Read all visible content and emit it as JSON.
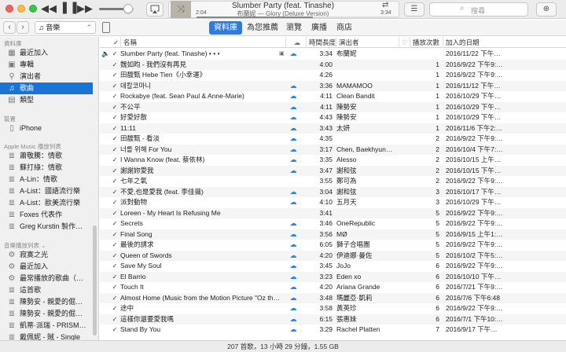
{
  "player": {
    "track_title": "Slumber Party (feat. Tinashe)",
    "track_sub": "布蘭妮 — Glory (Deluxe Version)",
    "elapsed": "2:04",
    "remaining": "3:34",
    "volume": 0.85
  },
  "search": {
    "placeholder": "搜尋"
  },
  "source_select": {
    "label": "音樂"
  },
  "tabs": [
    {
      "label": "資料庫",
      "active": true
    },
    {
      "label": "為您推薦"
    },
    {
      "label": "瀏覽"
    },
    {
      "label": "廣播"
    },
    {
      "label": "商店"
    }
  ],
  "sidebar": {
    "library_heading": "資料庫",
    "library": [
      {
        "label": "最近加入",
        "icon": "clock-icon"
      },
      {
        "label": "專輯",
        "icon": "album-icon"
      },
      {
        "label": "演出者",
        "icon": "microphone-icon"
      },
      {
        "label": "歌曲",
        "icon": "note-icon",
        "active": true
      },
      {
        "label": "類型",
        "icon": "genre-icon"
      }
    ],
    "devices_heading": "裝置",
    "devices": [
      {
        "label": "iPhone",
        "icon": "iphone-icon"
      }
    ],
    "applemusic_heading": "Apple Music 播放列表",
    "applemusic": [
      {
        "label": "蕭敬騰：情歌"
      },
      {
        "label": "蘇打綠：情歌"
      },
      {
        "label": "A-Lin：情歌"
      },
      {
        "label": "A-List：國語流行樂"
      },
      {
        "label": "A-List：歐美流行樂"
      },
      {
        "label": "Foxes 代表作"
      },
      {
        "label": "Greg Kurstin 製作…"
      }
    ],
    "music_playlists_heading": "音樂播放列表 ⌄",
    "music_playlists": [
      {
        "label": "寂寞之光",
        "icon": "gear-icon"
      },
      {
        "label": "最近加入",
        "icon": "gear-icon"
      },
      {
        "label": "最常播放的歌曲（…",
        "icon": "gear-icon"
      },
      {
        "label": "這首歌",
        "icon": "playlist-icon"
      },
      {
        "label": "陳勢安 - 親愛的倔…",
        "icon": "playlist-icon"
      },
      {
        "label": "陳勢安 - 親愛的倔…",
        "icon": "playlist-icon"
      },
      {
        "label": "凱蒂·派瑞 - PRISM…",
        "icon": "playlist-icon"
      },
      {
        "label": "戴佩妮 - 賊 - Single",
        "icon": "playlist-icon"
      }
    ]
  },
  "columns": {
    "name": "名稱",
    "time": "時間長度",
    "artist": "演出者",
    "plays": "播放次數",
    "date": "加入的日期"
  },
  "songs": [
    {
      "name": "Slumber Party (feat. Tinashe) • • •",
      "cloud": true,
      "time": "3:34",
      "artist": "布蘭妮",
      "plays": "",
      "date": "2016/11/22 下午…",
      "playing": true
    },
    {
      "name": "魏如昀 - 我們沒有再見",
      "cloud": false,
      "time": "4:00",
      "artist": "",
      "plays": "1",
      "date": "2016/9/22 下午9:…"
    },
    {
      "name": "田馥甄  Hebe Tien《小幸運》",
      "cloud": false,
      "time": "4:26",
      "artist": "",
      "plays": "1",
      "date": "2016/9/22 下午9:…"
    },
    {
      "name": "데칼코마니",
      "cloud": true,
      "time": "3:36",
      "artist": "MAMAMOO",
      "plays": "1",
      "date": "2016/11/12 下午…"
    },
    {
      "name": "Rockabye (feat. Sean Paul & Anne-Marie)",
      "cloud": true,
      "time": "4:11",
      "artist": "Clean Bandit",
      "plays": "1",
      "date": "2016/10/29 下午…"
    },
    {
      "name": "不公平",
      "cloud": true,
      "time": "4:11",
      "artist": "陳勢安",
      "plays": "1",
      "date": "2016/10/29 下午…"
    },
    {
      "name": "好愛好散",
      "cloud": true,
      "time": "4:43",
      "artist": "陳勢安",
      "plays": "1",
      "date": "2016/10/29 下午…"
    },
    {
      "name": "11:11",
      "cloud": true,
      "time": "3:43",
      "artist": "太妍",
      "plays": "1",
      "date": "2016/11/6 下午2:…"
    },
    {
      "name": "田馥甄 - 看淡",
      "cloud": true,
      "time": "4:35",
      "artist": "",
      "plays": "2",
      "date": "2016/9/22 下午9:…"
    },
    {
      "name": "너를 위해 For You",
      "cloud": true,
      "time": "3:17",
      "artist": "Chen, Baekhyun…",
      "plays": "2",
      "date": "2016/10/4 下午7:…"
    },
    {
      "name": "I Wanna Know (feat. 蔡依林)",
      "cloud": true,
      "time": "3:35",
      "artist": "Alesso",
      "plays": "2",
      "date": "2016/10/15 上午…"
    },
    {
      "name": "謝謝妳愛我",
      "cloud": true,
      "time": "3:47",
      "artist": "謝和弦",
      "plays": "2",
      "date": "2016/10/15 下午…"
    },
    {
      "name": "七年之氧",
      "cloud": false,
      "time": "3:55",
      "artist": "鄭可為",
      "plays": "2",
      "date": "2016/9/22 下午9:…"
    },
    {
      "name": "不愛,也是愛我 (feat. 李佳薇)",
      "cloud": true,
      "time": "3:04",
      "artist": "謝和弦",
      "plays": "3",
      "date": "2016/10/17 下午…"
    },
    {
      "name": "派對動物",
      "cloud": true,
      "time": "4:10",
      "artist": "五月天",
      "plays": "3",
      "date": "2016/10/29 下午…"
    },
    {
      "name": "Loreen - My Heart Is Refusing Me",
      "cloud": false,
      "time": "3:41",
      "artist": "",
      "plays": "5",
      "date": "2016/9/22 下午9:…"
    },
    {
      "name": "Secrets",
      "cloud": true,
      "time": "3:46",
      "artist": "OneRepublic",
      "plays": "5",
      "date": "2016/9/22 下午9:…"
    },
    {
      "name": "Final Song",
      "cloud": true,
      "time": "3:56",
      "artist": "MØ",
      "plays": "5",
      "date": "2016/9/15 上午1:…"
    },
    {
      "name": "最後的請求",
      "cloud": true,
      "time": "6:05",
      "artist": "獅子合唱團",
      "plays": "5",
      "date": "2016/9/22 下午9:…"
    },
    {
      "name": "Queen of Swords",
      "cloud": true,
      "time": "4:20",
      "artist": "伊迪娜·曼佐",
      "plays": "5",
      "date": "2016/10/2 下午5:…"
    },
    {
      "name": "Save My Soul",
      "cloud": true,
      "time": "3:45",
      "artist": "JoJo",
      "plays": "6",
      "date": "2016/9/22 下午9:…"
    },
    {
      "name": "El Barrio",
      "cloud": true,
      "time": "3:23",
      "artist": "Eden xo",
      "plays": "6",
      "date": "2016/10/10 下午…"
    },
    {
      "name": "Touch It",
      "cloud": true,
      "time": "4:20",
      "artist": "Ariana Grande",
      "plays": "6",
      "date": "2016/7/21 下午9:…"
    },
    {
      "name": "Almost Home (Music from the Motion Picture \"Oz th…",
      "cloud": true,
      "time": "3:48",
      "artist": "瑪麗亞·凱莉",
      "plays": "6",
      "date": "2016/7/6 下午6:48"
    },
    {
      "name": "途中",
      "cloud": true,
      "time": "3:58",
      "artist": "黃英珍",
      "plays": "6",
      "date": "2016/9/22 下午9:…"
    },
    {
      "name": "這樣你還要愛我嗎",
      "cloud": true,
      "time": "6:15",
      "artist": "張惠妹",
      "plays": "6",
      "date": "2016/7/1 下午10:…"
    },
    {
      "name": "Stand By You",
      "cloud": true,
      "time": "3:29",
      "artist": "Rachel Platten",
      "plays": "7",
      "date": "2016/9/17 下午…"
    }
  ],
  "status": "207 首歌，13 小時 29 分鐘，1.55 GB",
  "colors": {
    "accent": "#2c7be5",
    "selection": "#1a74d8",
    "cloud": "#2f86e0"
  }
}
